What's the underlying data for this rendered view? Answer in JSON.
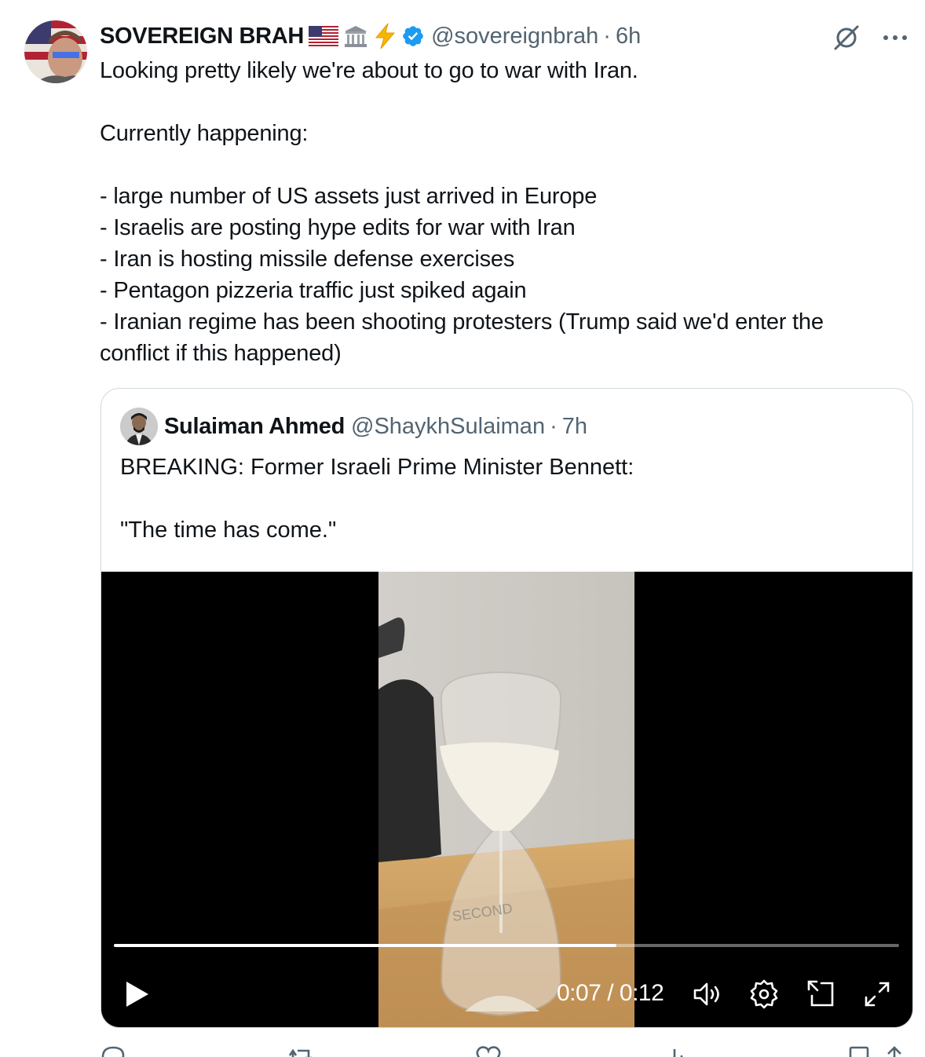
{
  "tweet": {
    "author_name": "SOVEREIGN BRAH",
    "name_emojis": [
      "flag-us-icon",
      "classical-building-icon",
      "lightning-icon"
    ],
    "verified": true,
    "handle": "@sovereignbrah",
    "separator": "·",
    "time": "6h",
    "body_lines": [
      "Looking pretty likely we're about to go to war with Iran.",
      "",
      "Currently happening:",
      "",
      "- large number of US assets just arrived in Europe",
      "- Israelis are posting hype edits for war with Iran",
      "- Iran is hosting missile defense exercises",
      "- Pentagon pizzeria traffic just spiked again",
      "- Iranian regime has been shooting protesters (Trump said we'd enter the",
      "conflict if this happened)"
    ]
  },
  "quote": {
    "author_name": "Sulaiman Ahmed",
    "handle": "@ShaykhSulaiman",
    "separator": "·",
    "time": "7h",
    "text_lines": [
      "BREAKING: Former Israeli Prime Minister Bennett:",
      "",
      "\"The time has come.\""
    ],
    "video": {
      "progress": 0.64,
      "current_time": "0:07",
      "duration": "0:12",
      "time_display": "0:07 / 0:12"
    }
  },
  "colors": {
    "text": "#0f1419",
    "secondary": "#536471",
    "verified": "#1d9bf0",
    "border": "#cfd9de"
  }
}
